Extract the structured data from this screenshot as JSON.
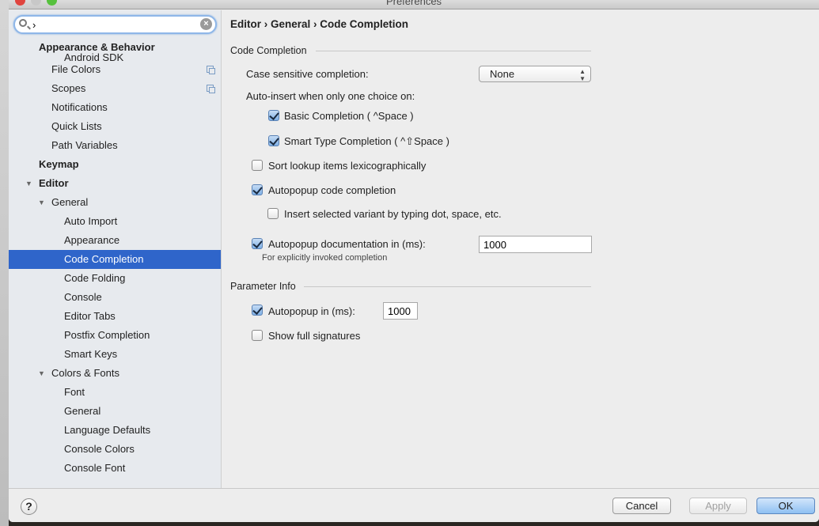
{
  "window": {
    "title": "Preferences"
  },
  "search": {
    "value": "›",
    "placeholder": ""
  },
  "sidebar": {
    "header": "Appearance & Behavior",
    "items": [
      {
        "label": "Android SDK",
        "level": 2
      },
      {
        "label": "File Colors",
        "level": 1,
        "icon": "copy-icon"
      },
      {
        "label": "Scopes",
        "level": 1,
        "icon": "copy-icon"
      },
      {
        "label": "Notifications",
        "level": 1
      },
      {
        "label": "Quick Lists",
        "level": 1
      },
      {
        "label": "Path Variables",
        "level": 1
      },
      {
        "label": "Keymap",
        "level": 0,
        "bold": true
      },
      {
        "label": "Editor",
        "level": 0,
        "bold": true,
        "expanded": true
      },
      {
        "label": "General",
        "level": 1,
        "expanded": true
      },
      {
        "label": "Auto Import",
        "level": 2
      },
      {
        "label": "Appearance",
        "level": 2
      },
      {
        "label": "Code Completion",
        "level": 2,
        "selected": true
      },
      {
        "label": "Code Folding",
        "level": 2
      },
      {
        "label": "Console",
        "level": 2
      },
      {
        "label": "Editor Tabs",
        "level": 2
      },
      {
        "label": "Postfix Completion",
        "level": 2
      },
      {
        "label": "Smart Keys",
        "level": 2
      },
      {
        "label": "Colors & Fonts",
        "level": 1,
        "expanded": true
      },
      {
        "label": "Font",
        "level": 2
      },
      {
        "label": "General",
        "level": 2
      },
      {
        "label": "Language Defaults",
        "level": 2
      },
      {
        "label": "Console Colors",
        "level": 2
      },
      {
        "label": "Console Font",
        "level": 2
      }
    ]
  },
  "main": {
    "breadcrumb": "Editor › General › Code Completion",
    "code_completion": {
      "title": "Code Completion",
      "case_sensitive_label": "Case sensitive completion:",
      "case_sensitive_value": "None",
      "auto_insert_label": "Auto-insert when only one choice on:",
      "basic": {
        "label": "Basic Completion ( ^Space )",
        "checked": true
      },
      "smart": {
        "label": "Smart Type Completion ( ^⇧Space )",
        "checked": true
      },
      "sort": {
        "label": "Sort lookup items lexicographically",
        "checked": false
      },
      "autopopup": {
        "label": "Autopopup code completion",
        "checked": true
      },
      "insert_variant": {
        "label": "Insert selected variant by typing dot, space, etc.",
        "checked": false
      },
      "autopopup_doc": {
        "label": "Autopopup documentation in (ms):",
        "checked": true,
        "value": "1000",
        "hint": "For explicitly invoked completion"
      }
    },
    "parameter_info": {
      "title": "Parameter Info",
      "autopopup": {
        "label": "Autopopup in (ms):",
        "checked": true,
        "value": "1000"
      },
      "full_signatures": {
        "label": "Show full signatures",
        "checked": false
      }
    }
  },
  "footer": {
    "help": "?",
    "cancel": "Cancel",
    "apply": "Apply",
    "ok": "OK"
  },
  "colors": {
    "selection": "#2f65ca",
    "sidebar_bg": "#e7eaee"
  }
}
